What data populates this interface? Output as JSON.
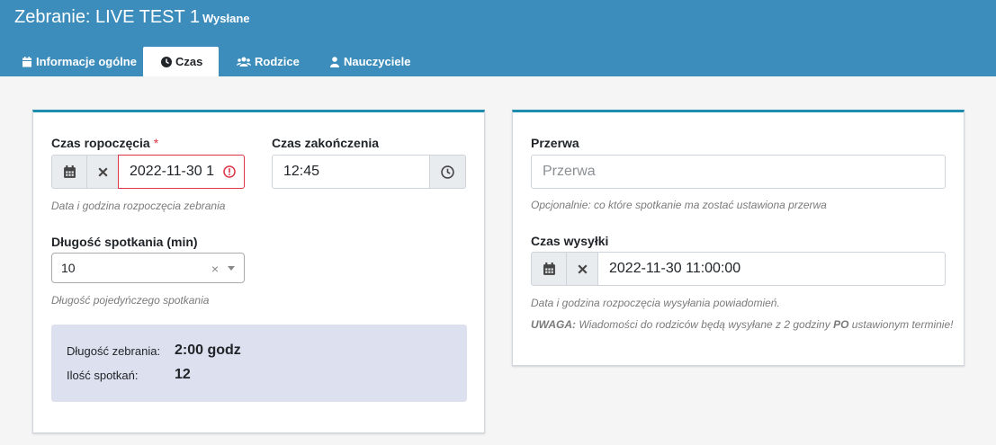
{
  "header": {
    "title": "Zebranie: LIVE TEST 1",
    "status": "Wysłane"
  },
  "tabs": [
    {
      "label": "Informacje ogólne",
      "icon": "calendar-icon",
      "active": false
    },
    {
      "label": "Czas",
      "icon": "clock-icon",
      "active": true
    },
    {
      "label": "Rodzice",
      "icon": "users-icon",
      "active": false
    },
    {
      "label": "Nauczyciele",
      "icon": "teacher-icon",
      "active": false
    }
  ],
  "left_panel": {
    "start": {
      "label": "Czas ropoczęcia",
      "required_mark": "*",
      "value": "2022-11-30 1",
      "help": "Data i godzina rozpoczęcia zebrania"
    },
    "end": {
      "label": "Czas zakończenia",
      "value": "12:45"
    },
    "duration": {
      "label": "Długość spotkania (min)",
      "value": "10",
      "clear": "×",
      "help": "Długość pojedyńczego spotkania"
    },
    "summary": {
      "meeting_length_label": "Długość zebrania:",
      "meeting_length_value": "2:00 godz",
      "meetings_count_label": "Ilość spotkań:",
      "meetings_count_value": "12"
    }
  },
  "right_panel": {
    "break": {
      "label": "Przerwa",
      "placeholder": "Przerwa",
      "help": "Opcjonalnie: co które spotkanie ma zostać ustawiona przerwa"
    },
    "send_time": {
      "label": "Czas wysyłki",
      "value": "2022-11-30 11:00:00",
      "help": "Data i godzina rozpoczęcia wysyłania powiadomień.",
      "warning_prefix": "UWAGA:",
      "warning_text_1": "Wiadomości do rodziców będą wysyłane z 2 godziny",
      "warning_bold": "PO",
      "warning_text_2": "ustawionym terminie!"
    }
  },
  "colors": {
    "header": "#3c8dbc",
    "panel_border": "#1e8cad",
    "error": "#dc3545",
    "summary_bg": "#dde0ee"
  }
}
